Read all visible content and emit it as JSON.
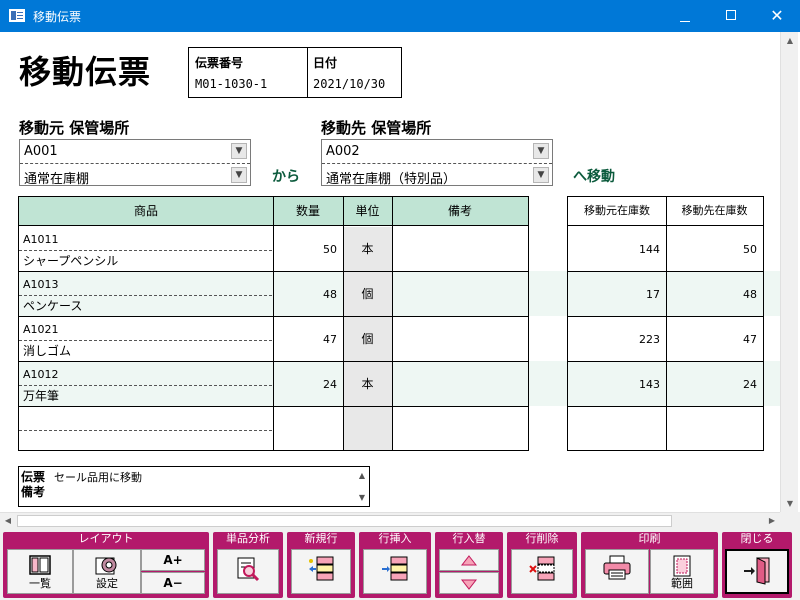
{
  "window": {
    "title": "移動伝票",
    "minimize": "minimize",
    "maximize": "maximize",
    "close": "✕"
  },
  "form": {
    "title": "移動伝票",
    "slip_no_label": "伝票番号",
    "slip_no": "M01-1030-1",
    "date_label": "日付",
    "date": "2021/10/30"
  },
  "source": {
    "label": "移動元 保管場所",
    "code": "A001",
    "name": "通常在庫棚"
  },
  "destination": {
    "label": "移動先 保管場所",
    "code": "A002",
    "name": "通常在庫棚（特別品）"
  },
  "connector_from": "から",
  "connector_to": "へ移動",
  "grid": {
    "headers": {
      "item": "商品",
      "qty": "数量",
      "unit": "単位",
      "note": "備考"
    },
    "rows": [
      {
        "code": "A1011",
        "name": "シャープペンシル",
        "qty": "50",
        "unit": "本",
        "note": ""
      },
      {
        "code": "A1013",
        "name": "ペンケース",
        "qty": "48",
        "unit": "個",
        "note": ""
      },
      {
        "code": "A1021",
        "name": "消しゴム",
        "qty": "47",
        "unit": "個",
        "note": ""
      },
      {
        "code": "A1012",
        "name": "万年筆",
        "qty": "24",
        "unit": "本",
        "note": ""
      }
    ]
  },
  "stock": {
    "headers": {
      "source": "移動元在庫数",
      "dest": "移動先在庫数"
    },
    "rows": [
      {
        "source": "144",
        "dest": "50"
      },
      {
        "source": "17",
        "dest": "48"
      },
      {
        "source": "223",
        "dest": "47"
      },
      {
        "source": "143",
        "dest": "24"
      }
    ]
  },
  "notes": {
    "label": "伝票備考",
    "value": "セール品用に移動"
  },
  "toolbar": {
    "layout": {
      "label": "レイアウト",
      "list": "一覧",
      "settings": "設定",
      "font_up": "A+",
      "font_down": "A−"
    },
    "analysis": {
      "label": "単品分析"
    },
    "new_row": {
      "label": "新規行"
    },
    "insert_row": {
      "label": "行挿入"
    },
    "swap_row": {
      "label": "行入替"
    },
    "delete_row": {
      "label": "行削除"
    },
    "print": {
      "label": "印刷",
      "range": "範囲"
    },
    "close": {
      "label": "閉じる"
    }
  },
  "colors": {
    "titlebar": "#0078d7",
    "header_green": "#c0e4d4",
    "toolbar_magenta": "#b3196b",
    "accent_text": "#0b5a3c"
  }
}
